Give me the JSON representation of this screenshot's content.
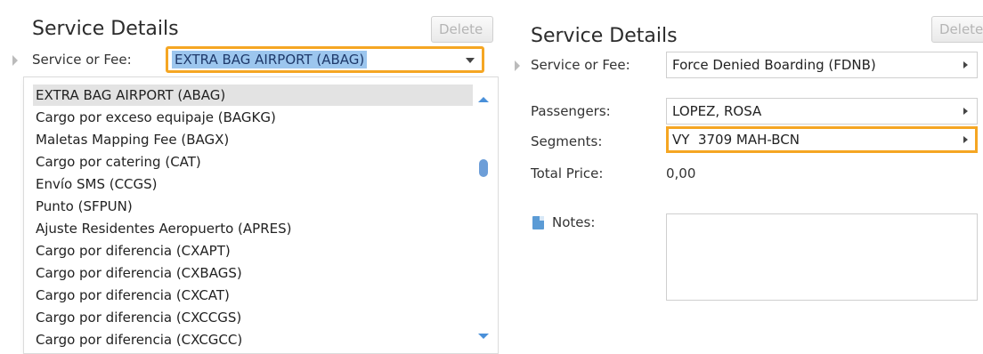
{
  "left": {
    "title": "Service Details",
    "delete_label": "Delete",
    "service_label": "Service or Fee:",
    "service_value": "EXTRA BAG AIRPORT (ABAG)",
    "options": [
      "EXTRA BAG AIRPORT (ABAG)",
      "Cargo por exceso equipaje (BAGKG)",
      "Maletas Mapping Fee (BAGX)",
      "Cargo por catering (CAT)",
      "Envío SMS (CCGS)",
      "Punto (SFPUN)",
      "Ajuste Residentes Aeropuerto (APRES)",
      "Cargo por diferencia (CXAPT)",
      "Cargo por diferencia (CXBAGS)",
      "Cargo por diferencia (CXCAT)",
      "Cargo por diferencia (CXCCGS)",
      "Cargo por diferencia (CXCGCC)"
    ]
  },
  "right": {
    "title": "Service Details",
    "delete_label": "Delete",
    "service_label": "Service or Fee:",
    "service_value": "Force Denied Boarding (FDNB)",
    "passengers_label": "Passengers:",
    "passengers_value": "LOPEZ, ROSA",
    "segments_label": "Segments:",
    "segments_value": "VY  3709 MAH-BCN",
    "total_label": "Total Price:",
    "total_value": "0,00",
    "notes_label": "Notes:",
    "notes_value": ""
  },
  "colors": {
    "highlight": "#f5a623",
    "selection": "#9cc6ee",
    "scroll": "#4a90d9"
  }
}
